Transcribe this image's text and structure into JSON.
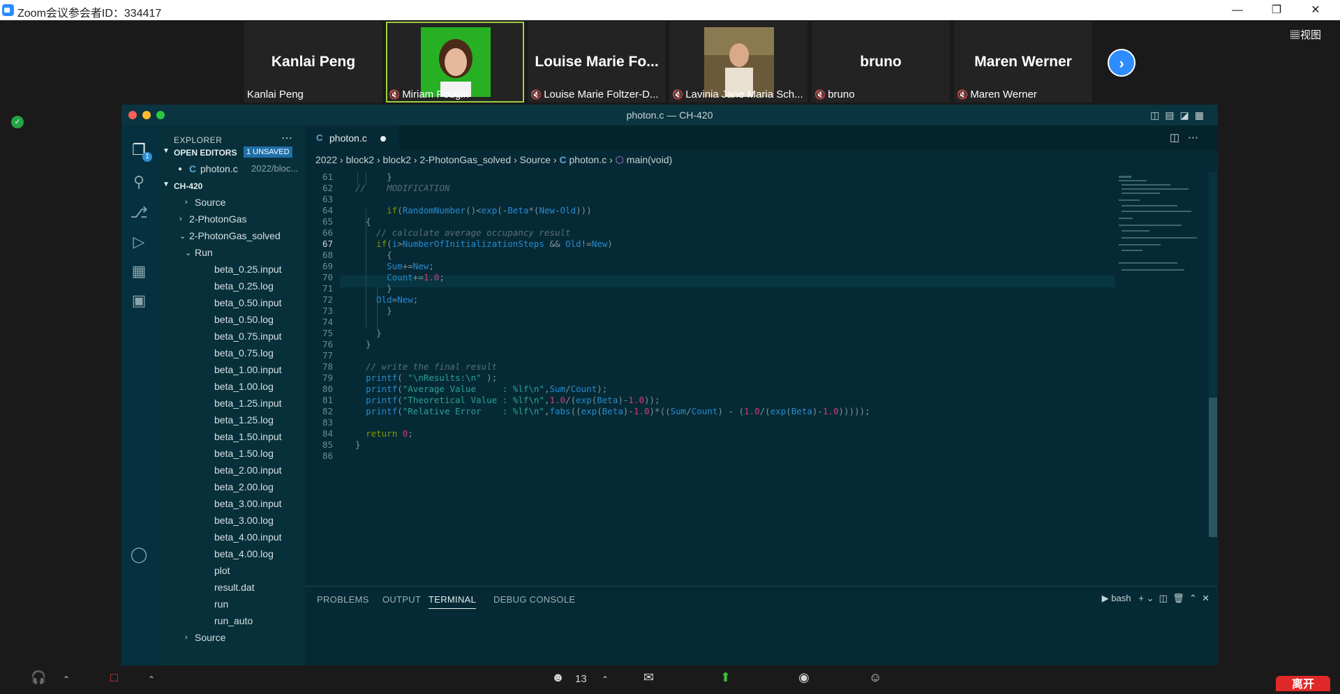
{
  "zoom": {
    "window_title": "Zoom会议参会者ID：334417",
    "view_label": "视图",
    "participant_count": "13",
    "leave_label": "离开",
    "participants": [
      {
        "big": "Kanlai Peng",
        "label": "Kanlai Peng",
        "muted": false
      },
      {
        "big": "",
        "label": "Miriam Pougin",
        "muted": true
      },
      {
        "big": "Louise Marie Fo...",
        "label": "Louise Marie Foltzer-D...",
        "muted": true
      },
      {
        "big": "",
        "label": "Lavinia Jane Maria Sch...",
        "muted": true
      },
      {
        "big": "bruno",
        "label": "bruno",
        "muted": true
      },
      {
        "big": "Maren Werner",
        "label": "Maren Werner",
        "muted": true
      }
    ]
  },
  "vscode": {
    "window_title": "photon.c — CH-420",
    "explorer_title": "EXPLORER",
    "open_editors_label": "OPEN EDITORS",
    "unsaved_badge": "1 UNSAVED",
    "activity_badge": "1",
    "open_editor_file": "photon.c",
    "open_editor_path": "2022/bloc...",
    "project_label": "CH-420",
    "tree": [
      {
        "name": "Source",
        "indent": 1,
        "kind": "folder"
      },
      {
        "name": "2-PhotonGas",
        "indent": 0,
        "kind": "folder"
      },
      {
        "name": "2-PhotonGas_solved",
        "indent": 0,
        "kind": "folder-open"
      },
      {
        "name": "Run",
        "indent": 1,
        "kind": "folder-open"
      },
      {
        "name": "beta_0.25.input",
        "indent": 2,
        "kind": "file"
      },
      {
        "name": "beta_0.25.log",
        "indent": 2,
        "kind": "file"
      },
      {
        "name": "beta_0.50.input",
        "indent": 2,
        "kind": "file"
      },
      {
        "name": "beta_0.50.log",
        "indent": 2,
        "kind": "file"
      },
      {
        "name": "beta_0.75.input",
        "indent": 2,
        "kind": "file"
      },
      {
        "name": "beta_0.75.log",
        "indent": 2,
        "kind": "file"
      },
      {
        "name": "beta_1.00.input",
        "indent": 2,
        "kind": "file"
      },
      {
        "name": "beta_1.00.log",
        "indent": 2,
        "kind": "file"
      },
      {
        "name": "beta_1.25.input",
        "indent": 2,
        "kind": "file"
      },
      {
        "name": "beta_1.25.log",
        "indent": 2,
        "kind": "file"
      },
      {
        "name": "beta_1.50.input",
        "indent": 2,
        "kind": "file"
      },
      {
        "name": "beta_1.50.log",
        "indent": 2,
        "kind": "file"
      },
      {
        "name": "beta_2.00.input",
        "indent": 2,
        "kind": "file"
      },
      {
        "name": "beta_2.00.log",
        "indent": 2,
        "kind": "file"
      },
      {
        "name": "beta_3.00.input",
        "indent": 2,
        "kind": "file"
      },
      {
        "name": "beta_3.00.log",
        "indent": 2,
        "kind": "file"
      },
      {
        "name": "beta_4.00.input",
        "indent": 2,
        "kind": "file"
      },
      {
        "name": "beta_4.00.log",
        "indent": 2,
        "kind": "file"
      },
      {
        "name": "plot",
        "indent": 2,
        "kind": "file"
      },
      {
        "name": "result.dat",
        "indent": 2,
        "kind": "file"
      },
      {
        "name": "run",
        "indent": 2,
        "kind": "file"
      },
      {
        "name": "run_auto",
        "indent": 2,
        "kind": "file"
      },
      {
        "name": "Source",
        "indent": 1,
        "kind": "folder"
      }
    ],
    "tab_label": "photon.c",
    "breadcrumbs": [
      "2022",
      "block2",
      "block2",
      "2-PhotonGas_solved",
      "Source",
      "photon.c",
      "main(void)"
    ],
    "line_numbers": [
      "61",
      "62",
      "63",
      "64",
      "65",
      "66",
      "67",
      "68",
      "69",
      "70",
      "71",
      "72",
      "73",
      "74",
      "75",
      "76",
      "77",
      "78",
      "79",
      "80",
      "81",
      "82",
      "83",
      "84",
      "85",
      "86"
    ],
    "panel_tabs": [
      "PROBLEMS",
      "OUTPUT",
      "TERMINAL",
      "DEBUG CONSOLE"
    ],
    "terminal_label": "bash",
    "colors": {
      "accent": "#2f8fd1",
      "editor_bg": "#062a35"
    }
  }
}
